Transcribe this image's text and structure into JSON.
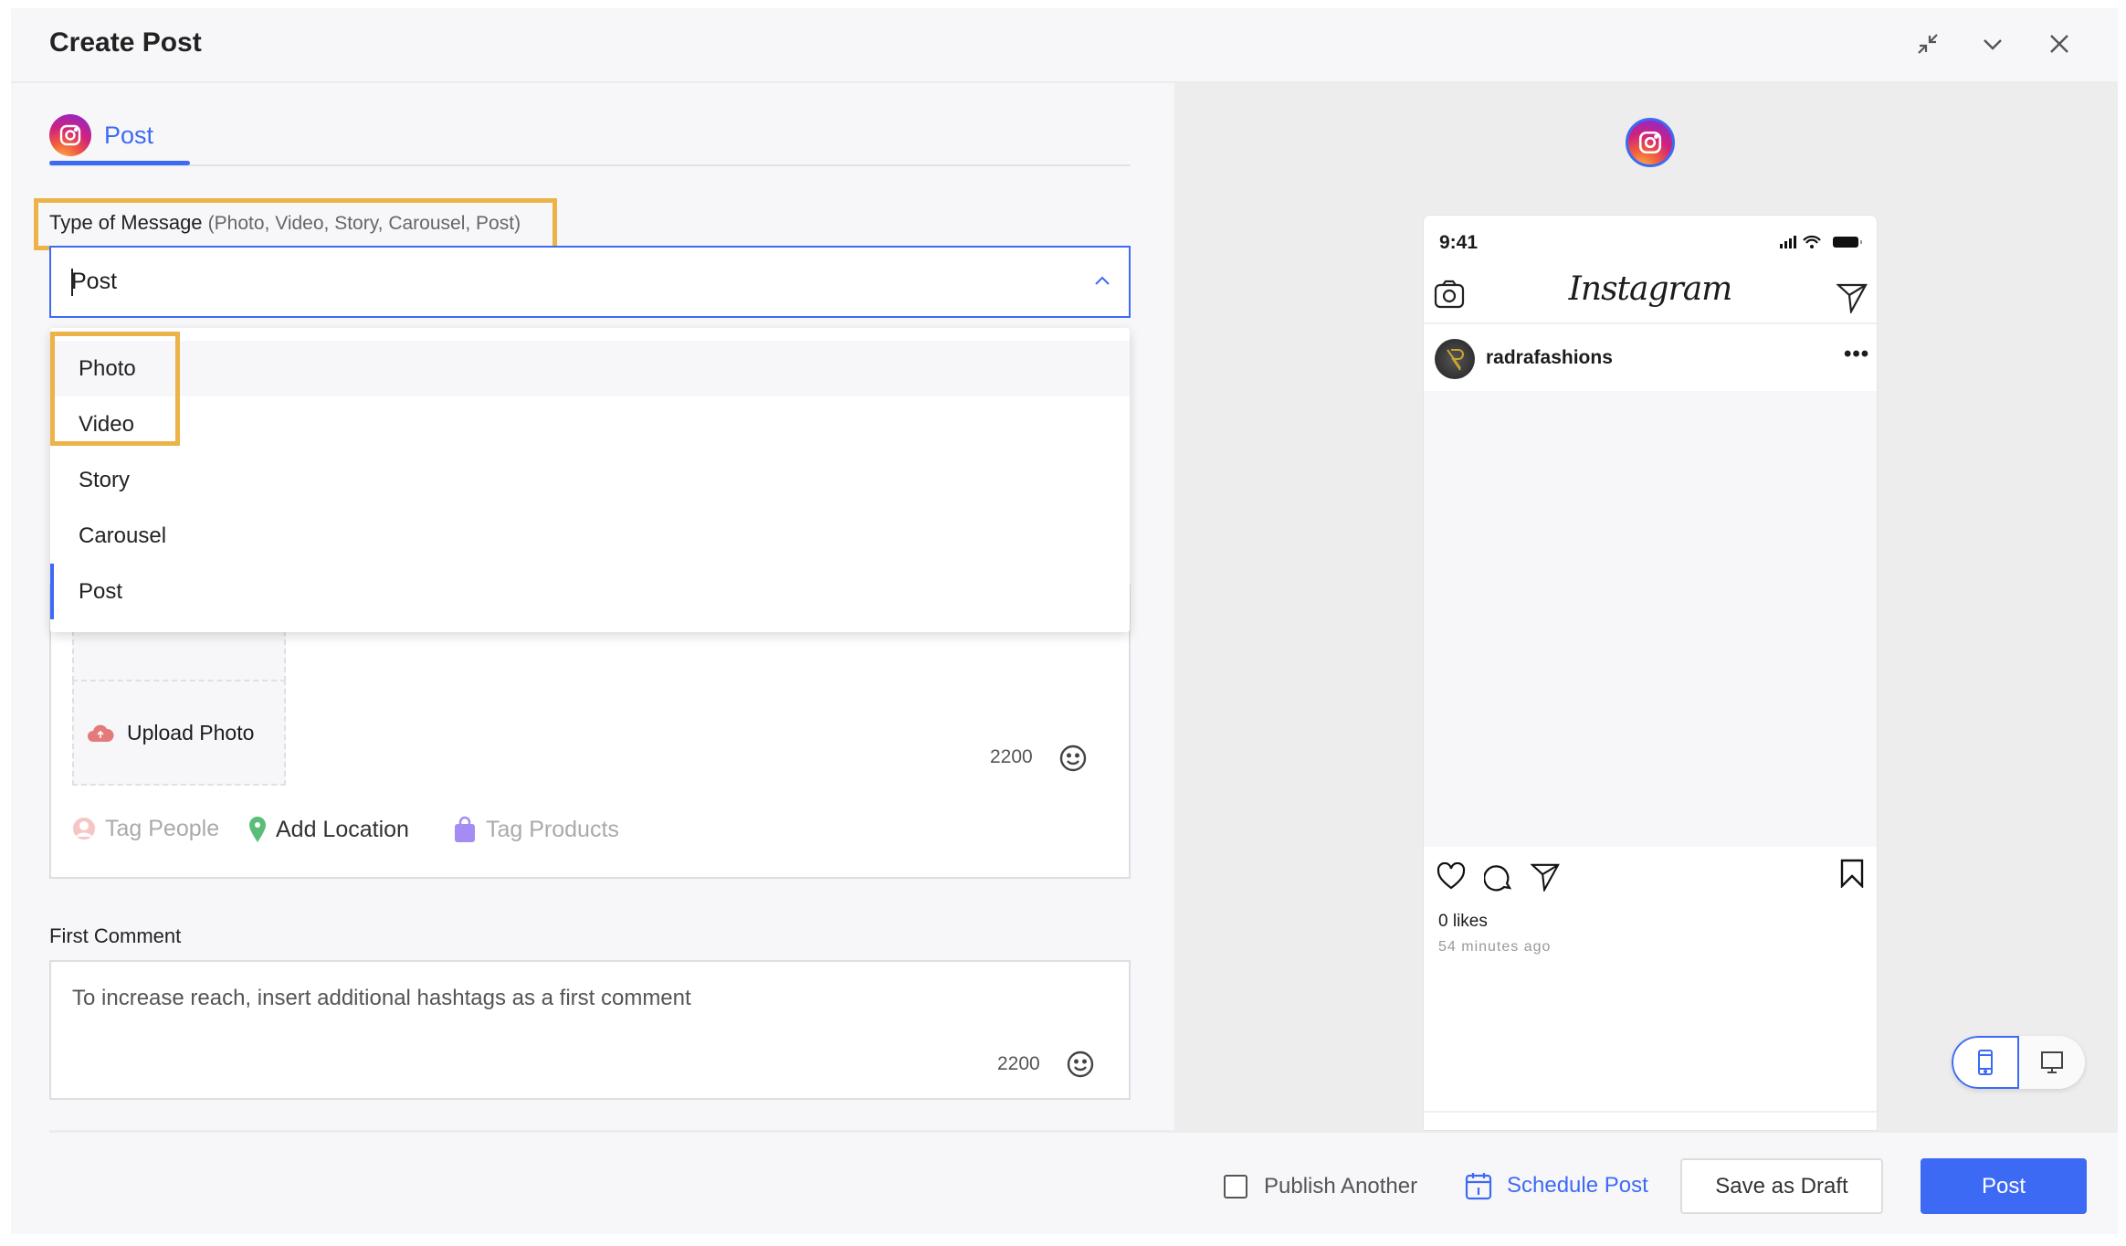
{
  "window": {
    "title": "Create Post",
    "controls": [
      "minimize-icon",
      "collapse-chevron-icon",
      "close-icon"
    ]
  },
  "tabs": [
    {
      "label": "Post",
      "icon": "instagram-icon",
      "active": true
    }
  ],
  "type_of_message": {
    "label": "Type of Message",
    "hint": "(Photo, Video, Story, Carousel, Post)",
    "value": "Post",
    "options": [
      "Photo",
      "Video",
      "Story",
      "Carousel",
      "Post"
    ],
    "selected": "Post",
    "hovered": "Photo"
  },
  "caption": {
    "upload_label": "Upload Photo",
    "char_count": "2200",
    "tags": [
      {
        "label": "Tag People",
        "icon": "person-icon",
        "enabled": false
      },
      {
        "label": "Add Location",
        "icon": "location-pin-icon",
        "enabled": true
      },
      {
        "label": "Tag Products",
        "icon": "shopping-bag-icon",
        "enabled": false
      }
    ]
  },
  "first_comment": {
    "label": "First Comment",
    "placeholder": "To increase reach, insert additional hashtags as a first comment",
    "char_count": "2200"
  },
  "preview": {
    "time": "9:41",
    "app_logo": "Instagram",
    "username": "radrafashions",
    "likes": "0 likes",
    "timestamp": "54 minutes ago",
    "view_mode": "mobile"
  },
  "footer": {
    "publish_another": "Publish Another",
    "publish_another_checked": false,
    "schedule": "Schedule Post",
    "draft": "Save as Draft",
    "post": "Post"
  },
  "colors": {
    "accent": "#3d6af5",
    "highlight": "#ecb348"
  }
}
